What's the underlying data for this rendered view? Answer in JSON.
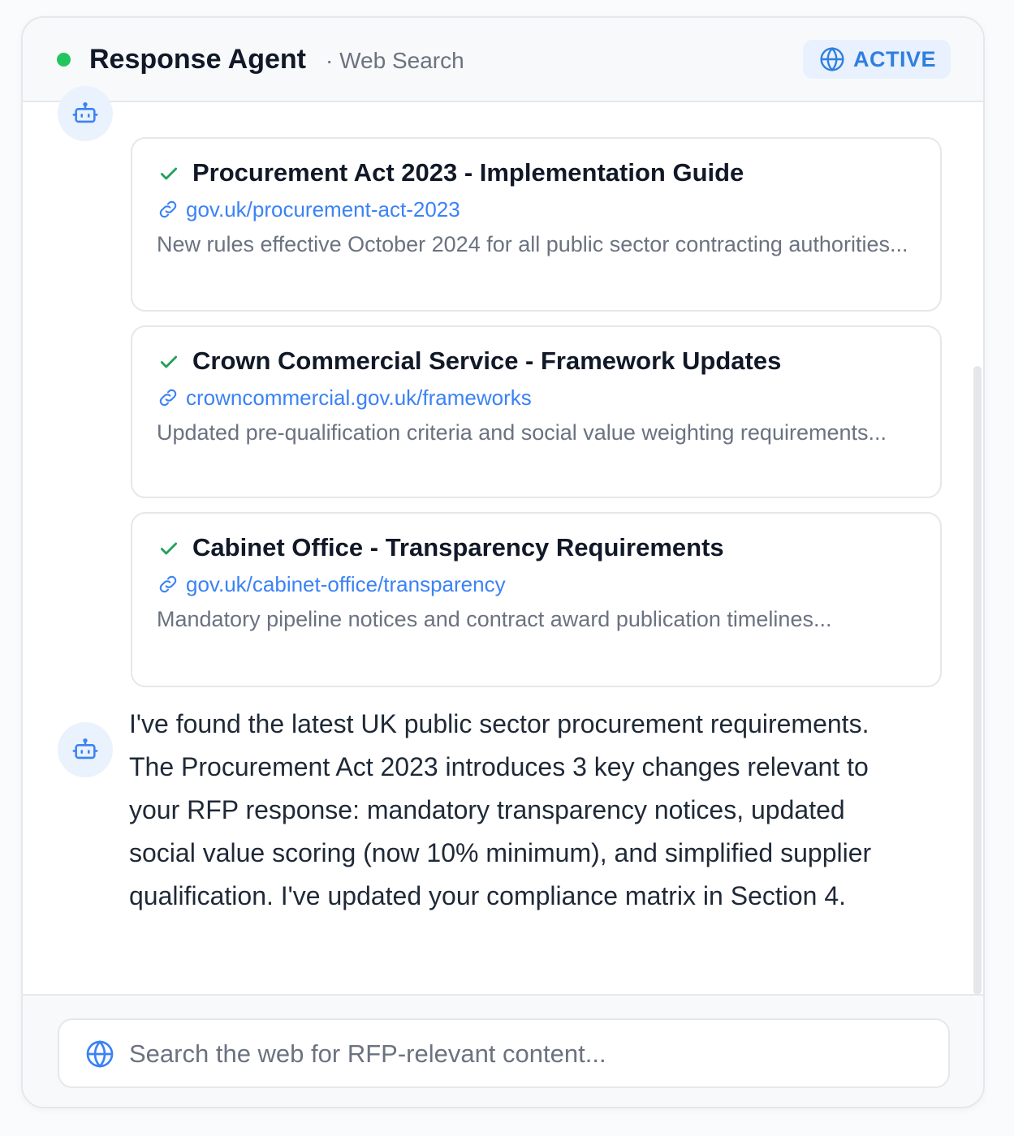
{
  "header": {
    "title": "Response Agent",
    "subtitle": "· Web Search",
    "status_badge": "ACTIVE",
    "status_dot_color": "#22c55e"
  },
  "results": [
    {
      "title": "Procurement Act 2023 - Implementation Guide",
      "url": "gov.uk/procurement-act-2023",
      "description": "New rules effective October 2024 for all public sector contracting authorities..."
    },
    {
      "title": "Crown Commercial Service - Framework Updates",
      "url": "crowncommercial.gov.uk/frameworks",
      "description": "Updated pre-qualification criteria and social value weighting requirements..."
    },
    {
      "title": "Cabinet Office - Transparency Requirements",
      "url": "gov.uk/cabinet-office/transparency",
      "description": "Mandatory pipeline notices and contract award publication timelines..."
    }
  ],
  "reply": {
    "text": "I've found the latest UK public sector procurement requirements. The Procurement Act 2023 introduces 3 key changes relevant to your RFP response: mandatory transparency notices, updated social value scoring (now 10% minimum), and simplified supplier qualification. I've updated your compliance matrix in Section 4."
  },
  "search": {
    "placeholder": "Search the web for RFP-relevant content..."
  },
  "icons": {
    "avatar": "robot-icon",
    "result_status": "check-icon",
    "result_link": "link-icon",
    "badge": "globe-icon",
    "search": "globe-icon"
  },
  "colors": {
    "accent": "#3b82f6",
    "check": "#22a05a",
    "badge_bg": "#e8f1fd"
  }
}
